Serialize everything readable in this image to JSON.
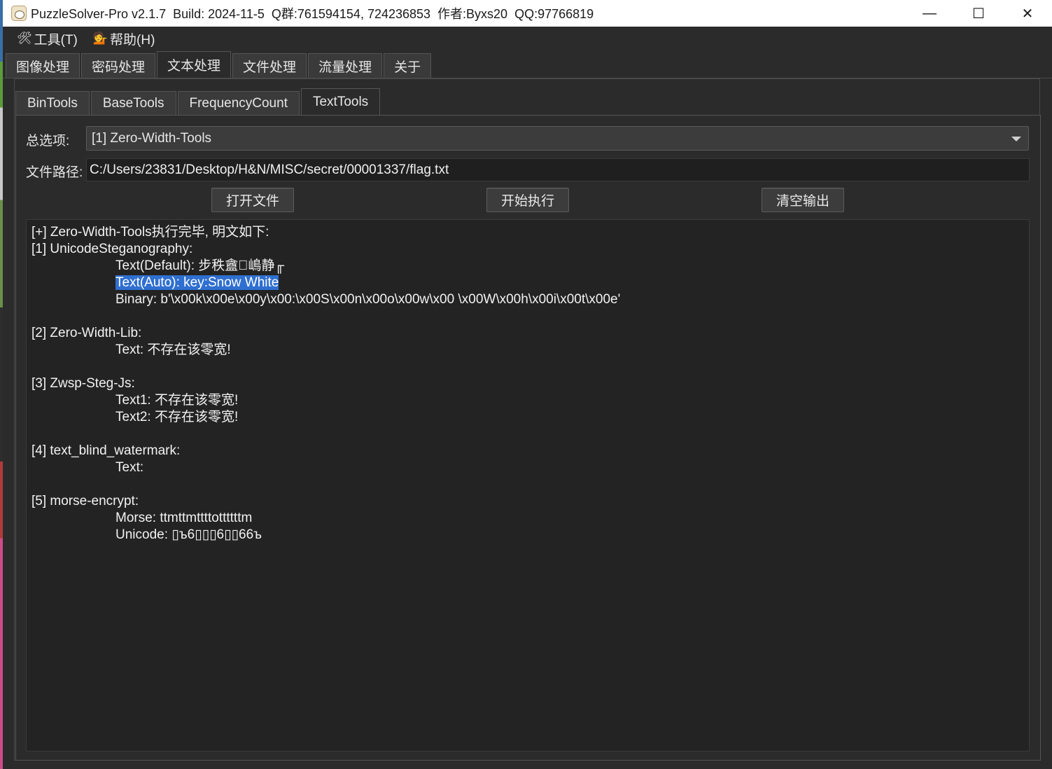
{
  "window": {
    "title": "PuzzleSolver-Pro v2.1.7  Build: 2024-11-5  Q群:761594154, 724236853  作者:Byxs20  QQ:97766819",
    "minimize": "—",
    "maximize": "☐",
    "close": "✕"
  },
  "menu": {
    "tools": "工具(T)",
    "tools_icon": "🛠",
    "help": "帮助(H)",
    "help_icon": "💁"
  },
  "outer_tabs": [
    "图像处理",
    "密码处理",
    "文本处理",
    "文件处理",
    "流量处理",
    "关于"
  ],
  "outer_active": 2,
  "inner_tabs": [
    "BinTools",
    "BaseTools",
    "FrequencyCount",
    "TextTools"
  ],
  "inner_active": 3,
  "form": {
    "option_label": "总选项:",
    "option_value": "[1] Zero-Width-Tools",
    "path_label": "文件路径:",
    "path_value": "C:/Users/23831/Desktop/H&N/MISC/secret/00001337/flag.txt"
  },
  "buttons": {
    "open": "打开文件",
    "run": "开始执行",
    "clear": "清空输出"
  },
  "output": [
    {
      "text": "[+] Zero-Width-Tools执行完毕, 明文如下:",
      "indent": false
    },
    {
      "text": "[1] UnicodeSteganography:",
      "indent": false
    },
    {
      "text": "Text(Default): 步秩盦\u0000嶋静╓",
      "indent": true
    },
    {
      "text": "Text(Auto): key:Snow White",
      "indent": true,
      "selected": true
    },
    {
      "text": "Binary: b'\\x00k\\x00e\\x00y\\x00:\\x00S\\x00n\\x00o\\x00w\\x00 \\x00W\\x00h\\x00i\\x00t\\x00e'",
      "indent": true
    },
    {
      "text": "",
      "indent": false
    },
    {
      "text": "[2] Zero-Width-Lib:",
      "indent": false
    },
    {
      "text": "Text: 不存在该零宽!",
      "indent": true
    },
    {
      "text": "",
      "indent": false
    },
    {
      "text": "[3] Zwsp-Steg-Js:",
      "indent": false
    },
    {
      "text": "Text1: 不存在该零宽!",
      "indent": true
    },
    {
      "text": "Text2: 不存在该零宽!",
      "indent": true
    },
    {
      "text": "",
      "indent": false
    },
    {
      "text": "[4] text_blind_watermark:",
      "indent": false
    },
    {
      "text": "Text:",
      "indent": true
    },
    {
      "text": "",
      "indent": false
    },
    {
      "text": "[5] morse-encrypt:",
      "indent": false
    },
    {
      "text": "Morse: ttmttmttttottttttm",
      "indent": true
    },
    {
      "text": "Unicode: ▯ъ6▯▯▯6▯▯66ъ",
      "indent": true
    }
  ]
}
